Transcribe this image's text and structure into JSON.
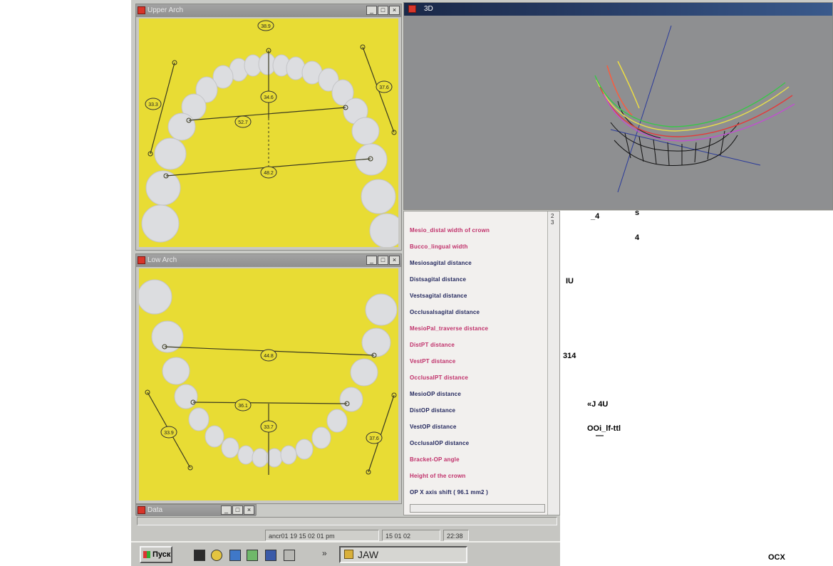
{
  "upper_window": {
    "title": "Upper Arch",
    "buttons": [
      "_",
      "□",
      "×"
    ],
    "labels": {
      "top": "38.9",
      "center": "34.6",
      "mid": "52.7",
      "molar": "48.2",
      "left": "33.3",
      "right": "37.6"
    }
  },
  "lower_window": {
    "title": "Low Arch",
    "buttons": [
      "_",
      "□",
      "×"
    ],
    "labels": {
      "molar": "44.8",
      "mid": "36.1",
      "center": "33.7",
      "left": "33.9",
      "right": "37.6"
    }
  },
  "view3d_window": {
    "title": "3D",
    "buttons": [
      "_",
      "□",
      "×"
    ]
  },
  "stub_window": {
    "title": "Data",
    "buttons": [
      "_",
      "□",
      "×"
    ]
  },
  "measurement_list": {
    "items": [
      {
        "label": "Mesio_distal width of crown",
        "tone": "pink"
      },
      {
        "label": "Bucco_lingual width",
        "tone": "pink"
      },
      {
        "label": "Mesiosagital distance",
        "tone": "navy"
      },
      {
        "label": "Distsagital distance",
        "tone": "navy"
      },
      {
        "label": "Vestsagital distance",
        "tone": "navy"
      },
      {
        "label": "Occlusalsagital distance",
        "tone": "navy"
      },
      {
        "label": "MesioPal_traverse distance",
        "tone": "pink"
      },
      {
        "label": "DistPT distance",
        "tone": "pink"
      },
      {
        "label": "VestPT distance",
        "tone": "pink"
      },
      {
        "label": "OcclusalPT distance",
        "tone": "pink"
      },
      {
        "label": "MesioOP distance",
        "tone": "navy"
      },
      {
        "label": "DistOP distance",
        "tone": "navy"
      },
      {
        "label": "VestOP distance",
        "tone": "navy"
      },
      {
        "label": "OcclusalOP distance",
        "tone": "navy"
      },
      {
        "label": "Bracket-OP angle",
        "tone": "pink"
      },
      {
        "label": "Height of the crown",
        "tone": "pink"
      },
      {
        "label": "OP X axis shift ( 96.1 mm2 )",
        "tone": "navy"
      }
    ],
    "scroll_ticks": [
      "2",
      "3"
    ]
  },
  "stray_text": {
    "a": "_4",
    "b": "s",
    "c": "4",
    "d": "IU",
    "e": "314",
    "f": "«J 4U",
    "g": "OOi_lf-ttl",
    "h": "—",
    "i": "OCX"
  },
  "statusbar": {
    "date_field": "ancr01 19 15 02 01 pm",
    "date_short": "15 01 02",
    "time": "22:38"
  },
  "taskbar": {
    "start_label": "Пуск",
    "task_label": "JAW",
    "tray_marker": "»"
  },
  "colors": {
    "arch_bg": "#e8dc34",
    "tooth": "#dcdde0",
    "view3d_bg": "#8e8f91",
    "title_dark": "#1a2848"
  }
}
